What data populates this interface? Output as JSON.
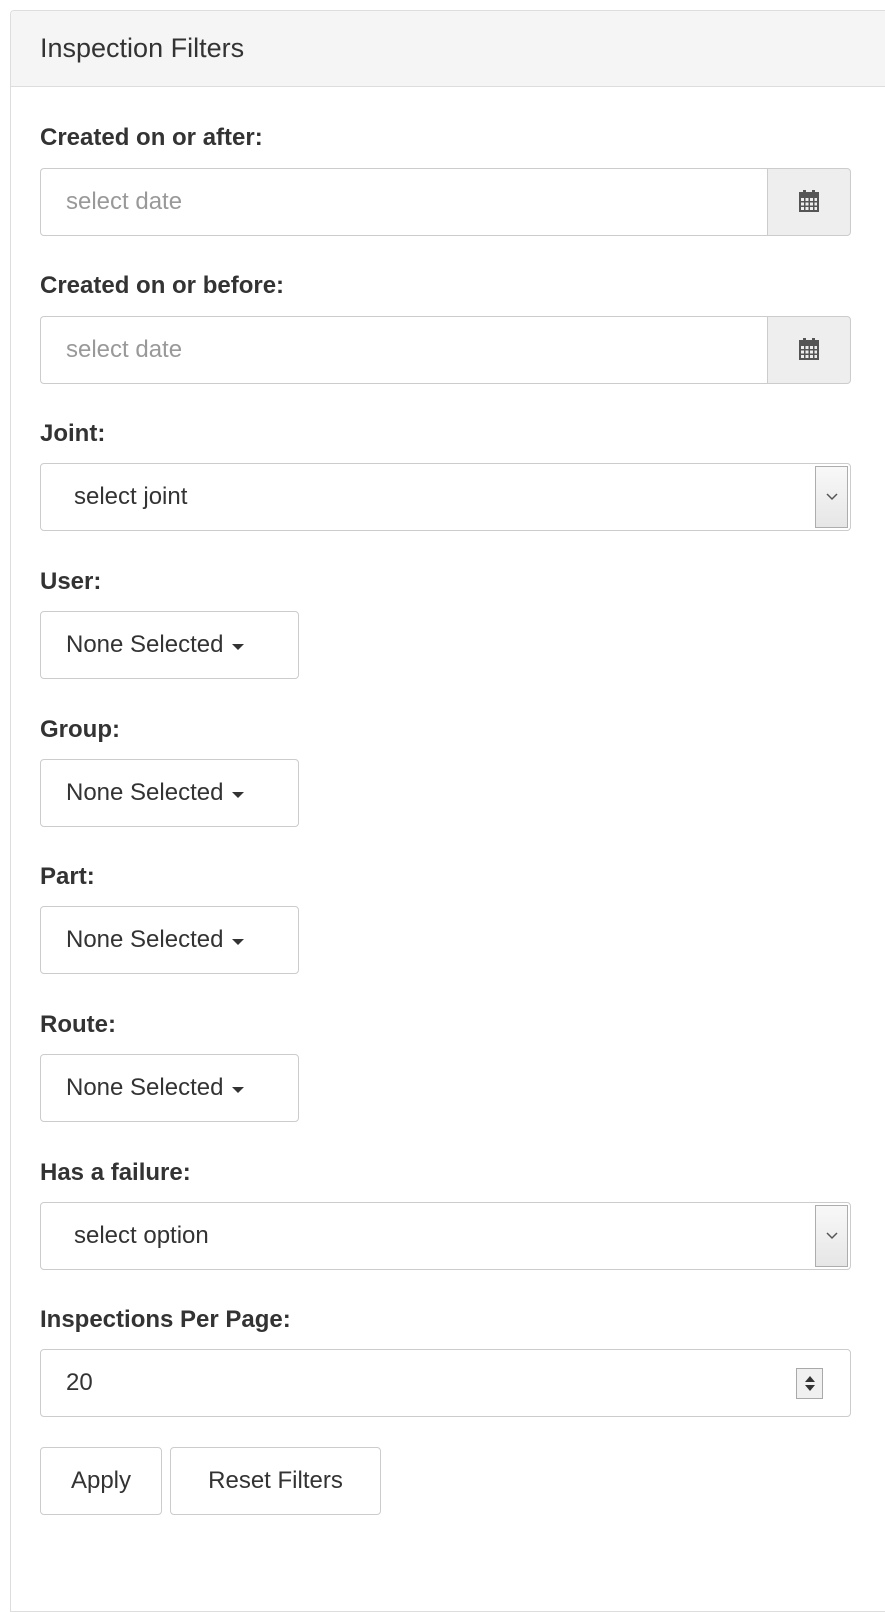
{
  "panel": {
    "title": "Inspection Filters"
  },
  "filters": {
    "created_after": {
      "label": "Created on or after:",
      "placeholder": "select date",
      "icon": "calendar-icon"
    },
    "created_before": {
      "label": "Created on or before:",
      "placeholder": "select date",
      "icon": "calendar-icon"
    },
    "joint": {
      "label": "Joint:",
      "selected": "select joint"
    },
    "user": {
      "label": "User:",
      "selected": "None Selected"
    },
    "group": {
      "label": "Group:",
      "selected": "None Selected"
    },
    "part": {
      "label": "Part:",
      "selected": "None Selected"
    },
    "route": {
      "label": "Route:",
      "selected": "None Selected"
    },
    "has_failure": {
      "label": "Has a failure:",
      "selected": "select option"
    },
    "per_page": {
      "label": "Inspections Per Page:",
      "value": "20"
    }
  },
  "actions": {
    "apply_label": "Apply",
    "reset_label": "Reset Filters"
  }
}
